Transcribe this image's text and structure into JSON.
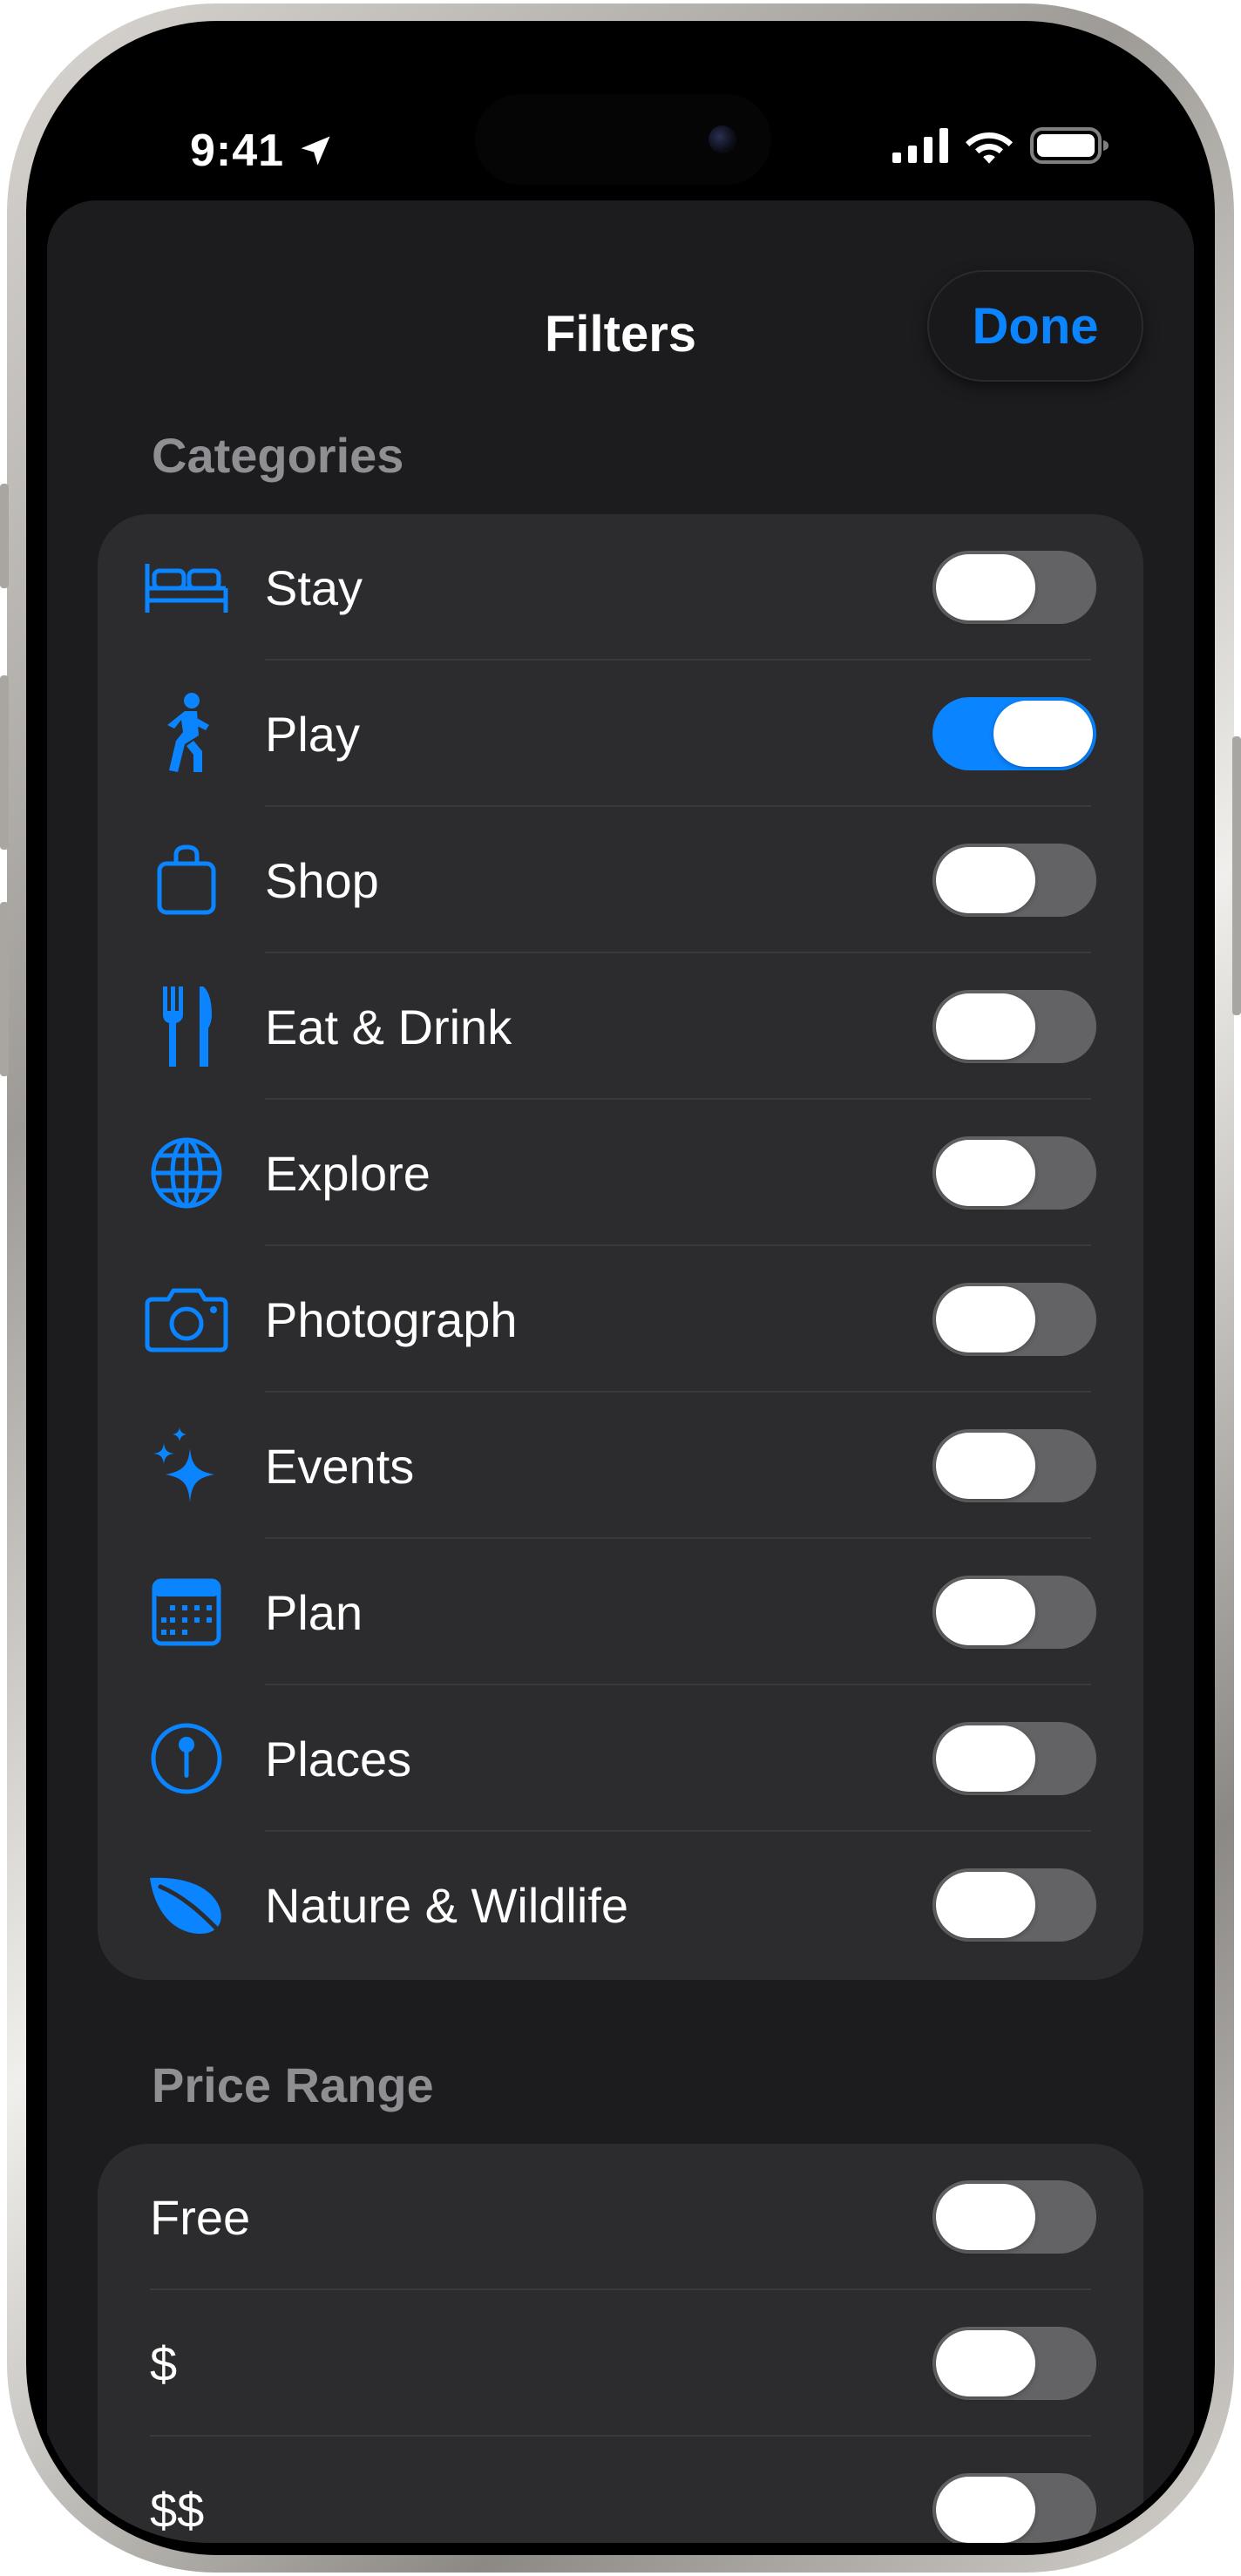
{
  "status_bar": {
    "time": "9:41",
    "icons": [
      "location-arrow-icon",
      "cellular-signal-icon",
      "wifi-icon",
      "battery-icon"
    ]
  },
  "sheet": {
    "title": "Filters",
    "done_label": "Done",
    "accent_color": "#0a84ff"
  },
  "categories": {
    "title": "Categories",
    "items": [
      {
        "label": "Stay",
        "icon": "bed-icon",
        "on": false
      },
      {
        "label": "Play",
        "icon": "figure-walk-icon",
        "on": true
      },
      {
        "label": "Shop",
        "icon": "shopping-bag-icon",
        "on": false
      },
      {
        "label": "Eat & Drink",
        "icon": "fork-knife-icon",
        "on": false
      },
      {
        "label": "Explore",
        "icon": "globe-icon",
        "on": false
      },
      {
        "label": "Photograph",
        "icon": "camera-icon",
        "on": false
      },
      {
        "label": "Events",
        "icon": "sparkles-icon",
        "on": false
      },
      {
        "label": "Plan",
        "icon": "calendar-icon",
        "on": false
      },
      {
        "label": "Places",
        "icon": "map-pin-icon",
        "on": false
      },
      {
        "label": "Nature & Wildlife",
        "icon": "leaf-icon",
        "on": false
      }
    ]
  },
  "price_range": {
    "title": "Price Range",
    "items": [
      {
        "label": "Free",
        "on": false
      },
      {
        "label": "$",
        "on": false
      },
      {
        "label": "$$",
        "on": false
      }
    ]
  }
}
